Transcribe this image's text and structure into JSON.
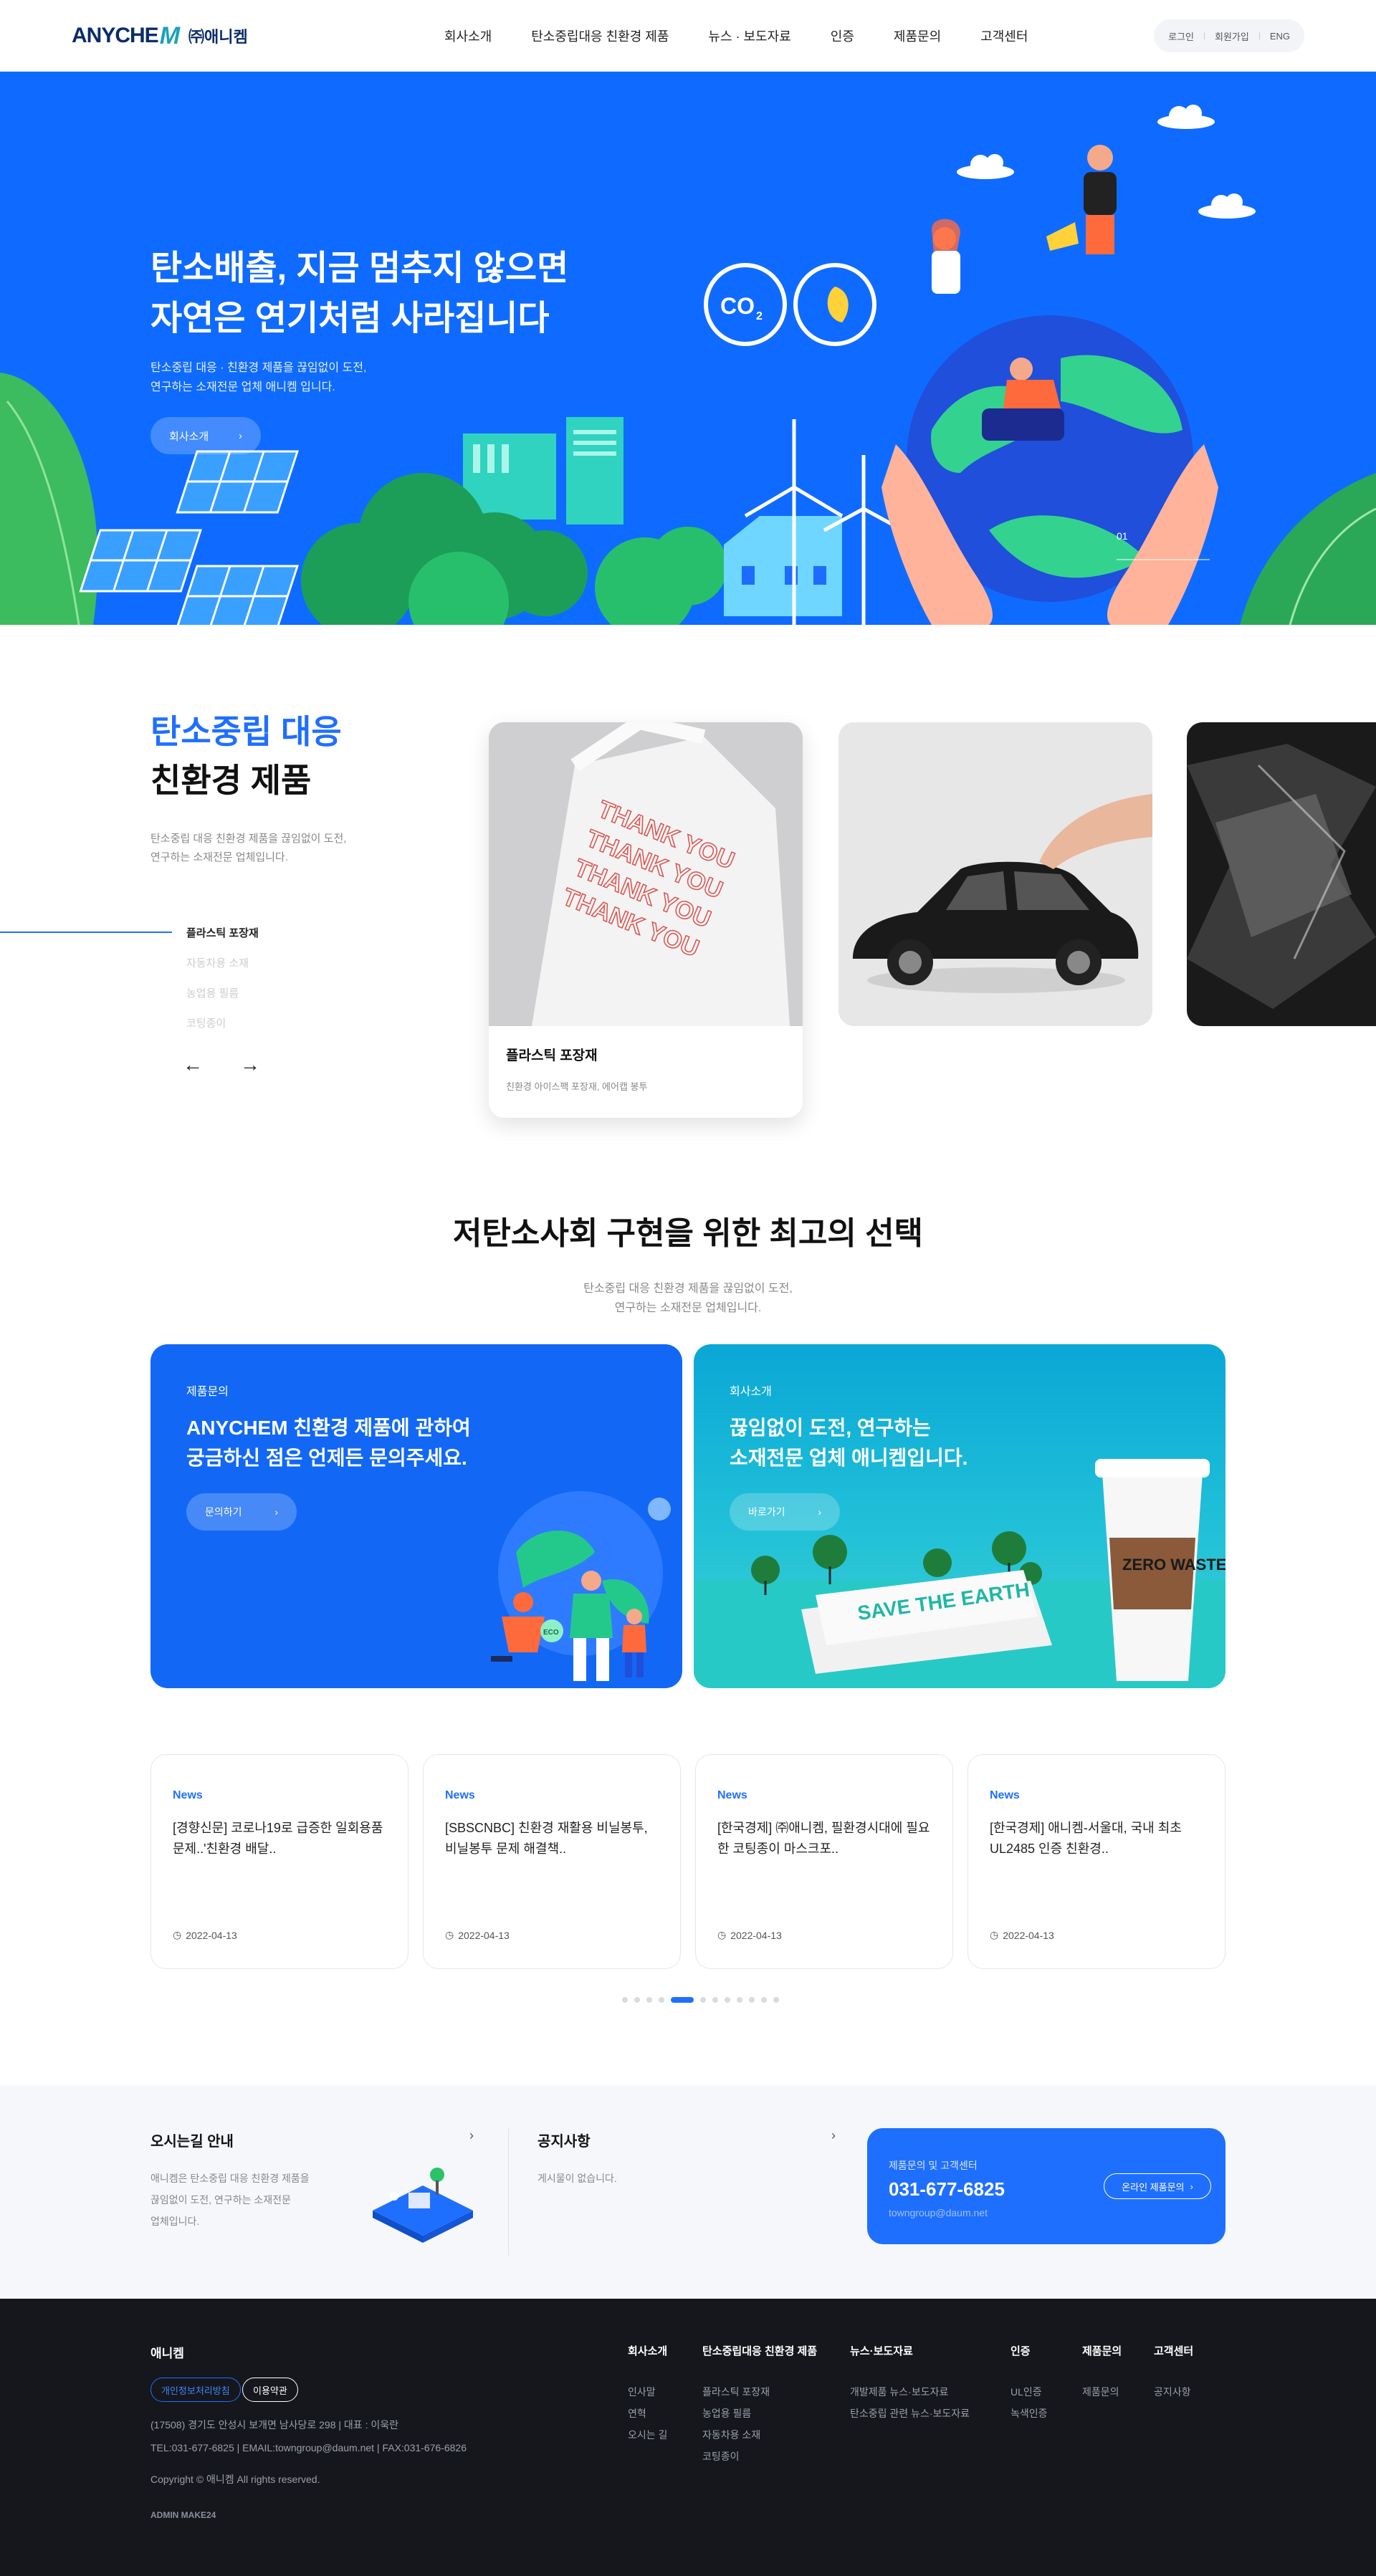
{
  "header": {
    "logo_en": "ANYCHE",
    "logo_m": "M",
    "logo_kr": "㈜애니켐",
    "nav": [
      "회사소개",
      "탄소중립대응 친환경 제품",
      "뉴스 · 보도자료",
      "인증",
      "제품문의",
      "고객센터"
    ],
    "util": [
      "로그인",
      "회원가입",
      "ENG"
    ]
  },
  "hero": {
    "title_line1": "탄소배출, 지금 멈추지 않으면",
    "title_line2": "자연은 연기처럼 사라집니다",
    "desc_line1": "탄소중립 대응 · 친환경 제품을 끊임없이 도전,",
    "desc_line2": "연구하는 소재전문 업체 애니켐 입니다.",
    "button": "회사소개",
    "slide_number": "01",
    "co2_label": "CO",
    "co2_sub": "2"
  },
  "products": {
    "title_blue": "탄소중립 대응",
    "title_black": "친환경 제품",
    "desc_line1": "탄소중립 대응 친환경 제품을 끊임없이 도전,",
    "desc_line2": "연구하는 소재전문 업체입니다.",
    "categories": [
      "플라스틱 포장재",
      "자동차용 소재",
      "농업용 필름",
      "코팅종이"
    ],
    "active_index": 0,
    "prev": "←",
    "next": "→",
    "card_name": "플라스틱 포장재",
    "card_sub": "친환경 아이스팩 포장재, 에어캡 봉투",
    "bag_text": "THANK YOU"
  },
  "best": {
    "title": "저탄소사회 구현을 위한 최고의 선택",
    "desc_line1": "탄소중립 대응 친환경 제품을 끊임없이 도전,",
    "desc_line2": "연구하는 소재전문 업체입니다.",
    "card1": {
      "tag": "제품문의",
      "title_line1": "ANYCHEM 친환경 제품에 관하여",
      "title_line2": "궁금하신 점은 언제든 문의주세요.",
      "button": "문의하기",
      "eco": "ECO"
    },
    "card2": {
      "tag": "회사소개",
      "title_line1": "끊임없이 도전, 연구하는",
      "title_line2": "소재전문 업체 애니켐입니다.",
      "button": "바로가기",
      "box_text": "SAVE THE EARTH",
      "cup_text": "ZERO WASTE"
    }
  },
  "news": {
    "items": [
      {
        "tag": "News",
        "title": "[경향신문] 코로나19로 급증한 일회용품 문제..'친환경 배달..",
        "date": "2022-04-13"
      },
      {
        "tag": "News",
        "title": "[SBSCNBC] 친환경 재활용 비닐봉투, 비닐봉투 문제 해결책..",
        "date": "2022-04-13"
      },
      {
        "tag": "News",
        "title": "[한국경제] ㈜애니켐, 필환경시대에 필요한 코팅종이 마스크포..",
        "date": "2022-04-13"
      },
      {
        "tag": "News",
        "title": "[한국경제] 애니켐-서울대, 국내 최초 UL2485 인증 친환경..",
        "date": "2022-04-13"
      }
    ],
    "dot_count": 12,
    "active_dot": 4
  },
  "info": {
    "directions_title": "오시는길 안내",
    "directions_line1": "애니켐은 탄소중립 대응 친환경 제품을",
    "directions_line2": "끊임없이 도전, 연구하는 소재전문",
    "directions_line3": "업체입니다.",
    "notice_title": "공지사항",
    "notice_text": "게시물이 없습니다.",
    "contact_label": "제품문의 및 고객센터",
    "contact_phone": "031-677-6825",
    "contact_email": "towngroup@daum.net",
    "contact_button": "온라인 제품문의",
    "chevron": "›"
  },
  "footer": {
    "brand": "애니켐",
    "privacy": "개인정보처리방침",
    "terms": "이용약관",
    "address": "(17508) 경기도 안성시 보개면 남사당로 298  |  대표 : 이욱란",
    "contacts": "TEL:031-677-6825  |  EMAIL:towngroup@daum.net  |  FAX:031-676-6826",
    "copyright": "Copyright © 애니켐 All rights reserved.",
    "admin": "ADMIN MAKE24",
    "columns": [
      {
        "title": "회사소개",
        "items": [
          "인사말",
          "연혁",
          "오시는 길"
        ]
      },
      {
        "title": "탄소중립대응 친환경 제품",
        "items": [
          "플라스틱 포장재",
          "농업용 필름",
          "자동차용 소재",
          "코팅종이"
        ]
      },
      {
        "title": "뉴스·보도자료",
        "items": [
          "개발제품 뉴스·보도자료",
          "탄소중립 관련 뉴스·보도자료"
        ]
      },
      {
        "title": "인증",
        "items": [
          "UL인증",
          "녹색인증"
        ]
      },
      {
        "title": "제품문의",
        "items": [
          "제품문의"
        ]
      },
      {
        "title": "고객센터",
        "items": [
          "공지사항"
        ]
      }
    ]
  },
  "colors": {
    "brand_blue": "#0f6bff",
    "accent_blue": "#1f6fff",
    "logo_navy": "#0b2b6b",
    "teal": "#1aa3b8",
    "footer_bg": "#15171c"
  }
}
